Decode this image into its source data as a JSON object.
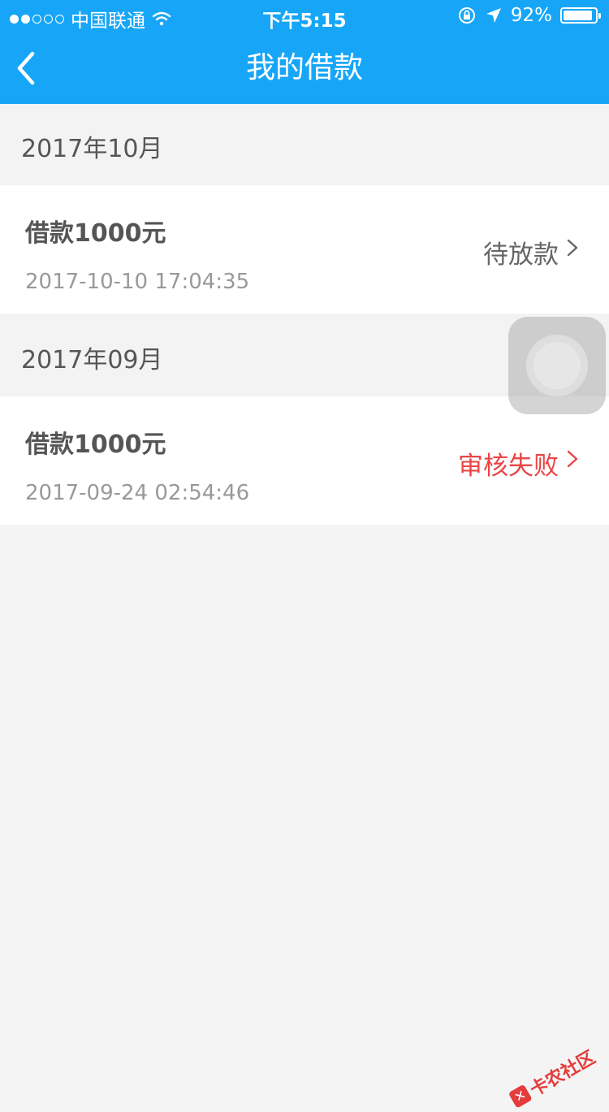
{
  "status_bar": {
    "carrier": "中国联通",
    "time": "下午5:15",
    "battery": "92%",
    "battery_level": 0.92
  },
  "nav": {
    "title": "我的借款"
  },
  "loans": [
    {
      "month": "2017年10月",
      "title": "借款1000元",
      "time": "2017-10-10 17:04:35",
      "status": "待放款"
    },
    {
      "month": "2017年09月",
      "title": "借款1000元",
      "time": "2017-09-24 02:54:46",
      "status": "审核失败"
    }
  ],
  "watermark": {
    "text": "卡农社区"
  },
  "colors": {
    "header": "#17a6f7",
    "fail": "#e94545"
  }
}
